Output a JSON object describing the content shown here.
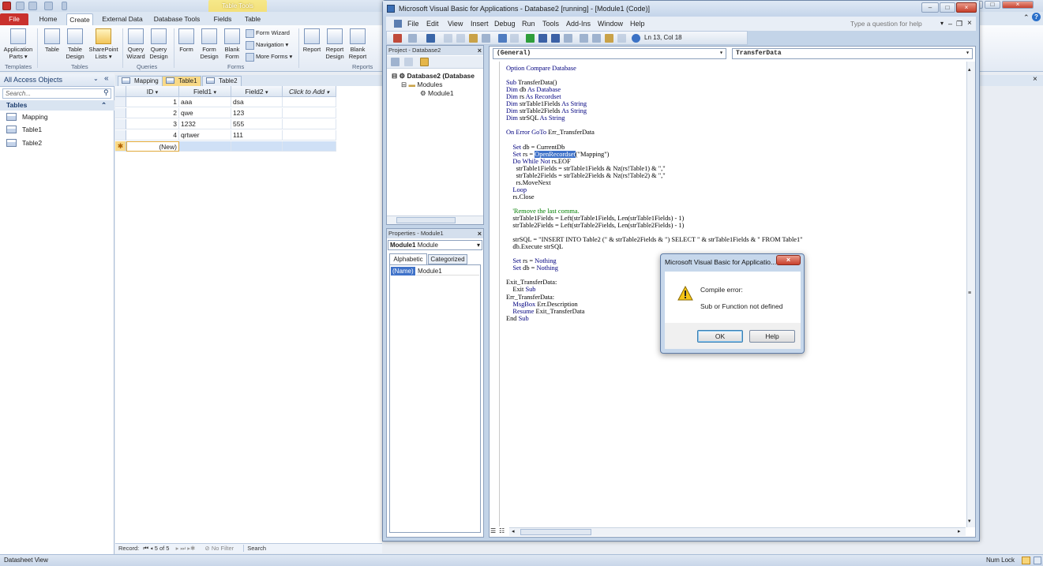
{
  "access": {
    "quick_access_caption": "Table Tools",
    "ribbon_tabs": [
      "File",
      "Home",
      "Create",
      "External Data",
      "Database Tools",
      "Fields",
      "Table"
    ],
    "ribbon_buttons": {
      "application_parts": "Application Parts ▾",
      "table": "Table",
      "table_design": "Table Design",
      "sharepoint_lists": "SharePoint Lists ▾",
      "query_wizard": "Query Wizard",
      "query_design": "Query Design",
      "form": "Form",
      "form_design": "Form Design",
      "blank_form": "Blank Form",
      "form_wizard": "Form Wizard",
      "navigation": "Navigation ▾",
      "more_forms": "More Forms ▾",
      "report": "Report",
      "report_design": "Report Design",
      "blank_report": "Blank Report"
    },
    "ribbon_groups": [
      "Templates",
      "Tables",
      "Queries",
      "Forms",
      "Reports"
    ],
    "nav": {
      "header": "All Access Objects",
      "search_placeholder": "Search...",
      "group": "Tables",
      "items": [
        "Mapping",
        "Table1",
        "Table2"
      ]
    },
    "doc_tabs": [
      "Mapping",
      "Table1",
      "Table2"
    ],
    "datasheet": {
      "columns": [
        "ID",
        "Field1",
        "Field2",
        "Click to Add"
      ],
      "rows": [
        [
          "1",
          "aaa",
          "dsa"
        ],
        [
          "2",
          "qwe",
          "123"
        ],
        [
          "3",
          "1232",
          "555"
        ],
        [
          "4",
          "qrtwer",
          "111"
        ]
      ],
      "new_row_label": "(New)",
      "new_row_marker": "✱"
    },
    "record_nav": {
      "label": "Record:",
      "position": "5 of 5",
      "filter": "No Filter",
      "search": "Search"
    },
    "status": {
      "left": "Datasheet View",
      "right": "Num Lock"
    }
  },
  "vba": {
    "title": "Microsoft Visual Basic for Applications - Database2 [running] - [Module1 (Code)]",
    "menus": [
      "File",
      "Edit",
      "View",
      "Insert",
      "Debug",
      "Run",
      "Tools",
      "Add-Ins",
      "Window",
      "Help"
    ],
    "help_placeholder": "Type a question for help",
    "cursor_pos": "Ln 13, Col 18",
    "project": {
      "title": "Project - Database2",
      "root": "Database2 (Database",
      "folder": "Modules",
      "module": "Module1"
    },
    "properties": {
      "title": "Properties - Module1",
      "object_name": "Module1",
      "object_type": "Module",
      "tab_alpha": "Alphabetic",
      "tab_cat": "Categorized",
      "prop_name": "(Name)",
      "prop_value": "Module1"
    },
    "code": {
      "object_combo": "(General)",
      "proc_combo": "TransferData",
      "lines": [
        "Option Compare Database",
        "",
        "Sub TransferData()",
        "Dim db As Database",
        "Dim rs As Recordset",
        "Dim strTable1Fields As String",
        "Dim strTable2Fields As String",
        "Dim strSQL As String",
        "",
        "On Error GoTo Err_TransferData",
        "",
        "    Set db = CurrentDb",
        "    Set rs = OpenRecordset(\"Mapping\")",
        "    Do While Not rs.EOF",
        "      strTable1Fields = strTable1Fields & Nz(rs!Table1) & \",\"",
        "      strTable2Fields = strTable2Fields & Nz(rs!Table2) & \",\"",
        "      rs.MoveNext",
        "    Loop",
        "    rs.Close",
        "",
        "    'Remove the last comma.",
        "    strTable1Fields = Left(strTable1Fields, Len(strTable1Fields) - 1)",
        "    strTable2Fields = Left(strTable2Fields, Len(strTable2Fields) - 1)",
        "",
        "    strSQL = \"INSERT INTO Table2 (\" & strTable2Fields & \") SELECT \" & strTable1Fields & \" FROM Table1\"",
        "    db.Execute strSQL",
        "",
        "    Set rs = Nothing",
        "    Set db = Nothing",
        "",
        "Exit_TransferData:",
        "    Exit Sub",
        "Err_TransferData:",
        "    MsgBox Err.Description",
        "    Resume Exit_TransferData",
        "End Sub"
      ],
      "highlight_word": "OpenRecordset"
    }
  },
  "dialog": {
    "title": "Microsoft Visual Basic for Applicatio...",
    "heading": "Compile error:",
    "message": "Sub or Function not defined",
    "ok": "OK",
    "help": "Help"
  },
  "colors": {
    "file_tab": "#c9312d",
    "selection": "#3f72c9",
    "keyword": "#00007f",
    "comment": "#007f00",
    "new_row": "#cfe0f6"
  }
}
